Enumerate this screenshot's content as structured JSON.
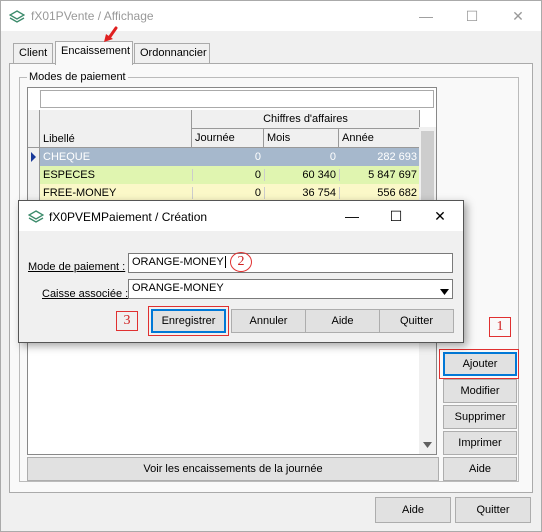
{
  "window": {
    "title": "fX01PVente / Affichage",
    "minimize": "—",
    "maximize": "☐",
    "close": "✕"
  },
  "tabs": [
    {
      "label": "Client"
    },
    {
      "label": "Encaissement"
    },
    {
      "label": "Ordonnancier"
    }
  ],
  "groupbox": {
    "label": "Modes de paiement"
  },
  "grid": {
    "headers": {
      "libelle": "Libellé",
      "chiffres": "Chiffres d'affaires",
      "journee": "Journée",
      "mois": "Mois",
      "annee": "Année"
    },
    "rows": [
      {
        "libelle": "CHEQUE",
        "journee": "0",
        "mois": "0",
        "annee": "282 693"
      },
      {
        "libelle": "ESPECES",
        "journee": "0",
        "mois": "60 340",
        "annee": "5 847 697"
      },
      {
        "libelle": "FREE-MONEY",
        "journee": "0",
        "mois": "36 754",
        "annee": "556 682"
      }
    ]
  },
  "side_buttons": {
    "ajouter": "Ajouter",
    "modifier": "Modifier",
    "supprimer": "Supprimer",
    "imprimer": "Imprimer",
    "aide": "Aide"
  },
  "view_day_button": "Voir les encaissements de la journée",
  "footer": {
    "aide": "Aide",
    "quitter": "Quitter"
  },
  "dialog": {
    "title": "fX0PVEMPaiement / Création",
    "mode_label": "Mode de paiement :",
    "mode_value": "ORANGE-MONEY",
    "caisse_label": "Caisse associée :",
    "caisse_value": "ORANGE-MONEY",
    "buttons": {
      "enregistrer": "Enregistrer",
      "annuler": "Annuler",
      "aide": "Aide",
      "quitter": "Quitter"
    }
  },
  "callouts": [
    "1",
    "2",
    "3"
  ],
  "colors": {
    "selected_row": "#a6b8cc",
    "especes_row": "#e0f5b0",
    "free_row": "#fbf8c8",
    "annotation_red": "#e03030"
  }
}
